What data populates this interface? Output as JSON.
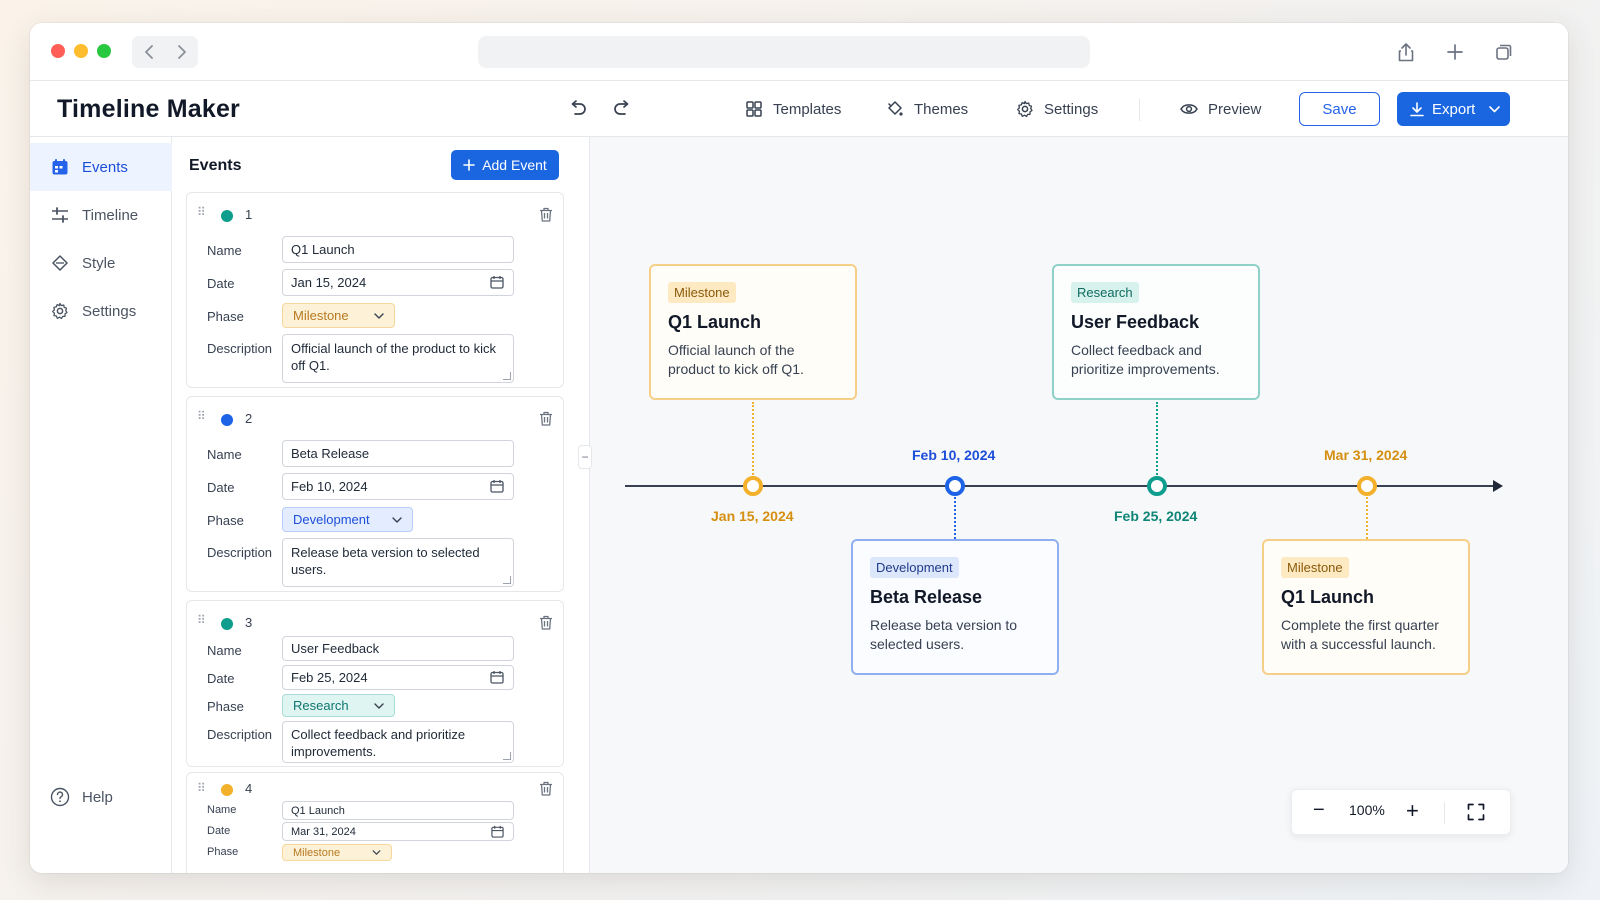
{
  "app": {
    "title": "Timeline Maker"
  },
  "toolbar": {
    "templates": "Templates",
    "themes": "Themes",
    "settings": "Settings",
    "preview": "Preview",
    "save": "Save",
    "export": "Export"
  },
  "sidebar": {
    "items": [
      {
        "label": "Events",
        "icon": "calendar-icon"
      },
      {
        "label": "Timeline",
        "icon": "sliders-icon"
      },
      {
        "label": "Style",
        "icon": "paint-icon"
      },
      {
        "label": "Settings",
        "icon": "gear-icon"
      }
    ],
    "help": "Help"
  },
  "events_panel": {
    "title": "Events",
    "add_button": "Add Event",
    "labels": {
      "name": "Name",
      "date": "Date",
      "phase": "Phase",
      "description": "Description"
    },
    "events": [
      {
        "num": "1",
        "color": "#0f9e8e",
        "name": "Q1 Launch",
        "date": "Jan 15, 2024",
        "phase": "Milestone",
        "description": "Official launch of the product to kick off Q1."
      },
      {
        "num": "2",
        "color": "#1d63e6",
        "name": "Beta Release",
        "date": "Feb 10, 2024",
        "phase": "Development",
        "description": "Release beta version to selected users."
      },
      {
        "num": "3",
        "color": "#0f9e8e",
        "name": "User Feedback",
        "date": "Feb 25, 2024",
        "phase": "Research",
        "description": "Collect feedback and prioritize improvements."
      },
      {
        "num": "4",
        "color": "#f2b02b",
        "name": "Q1 Launch",
        "date": "Mar 31, 2024",
        "phase": "Milestone"
      }
    ]
  },
  "timeline": {
    "cards": [
      {
        "badge": "Milestone",
        "title": "Q1 Launch",
        "desc": "Official launch of the product to kick off Q1.",
        "date": "Jan 15, 2024"
      },
      {
        "badge": "Development",
        "title": "Beta Release",
        "desc": "Release beta version to selected users.",
        "date": "Feb 10, 2024"
      },
      {
        "badge": "Research",
        "title": "User Feedback",
        "desc": "Collect feedback and prioritize improvements.",
        "date": "Feb 25, 2024"
      },
      {
        "badge": "Milestone",
        "title": "Q1 Launch",
        "desc": "Complete the first quarter with a successful launch.",
        "date": "Mar 31, 2024"
      }
    ],
    "colors": {
      "milestone": "#f2b02b",
      "development": "#1d63e6",
      "research": "#0f9e8e"
    }
  },
  "zoom": {
    "level": "100%"
  }
}
